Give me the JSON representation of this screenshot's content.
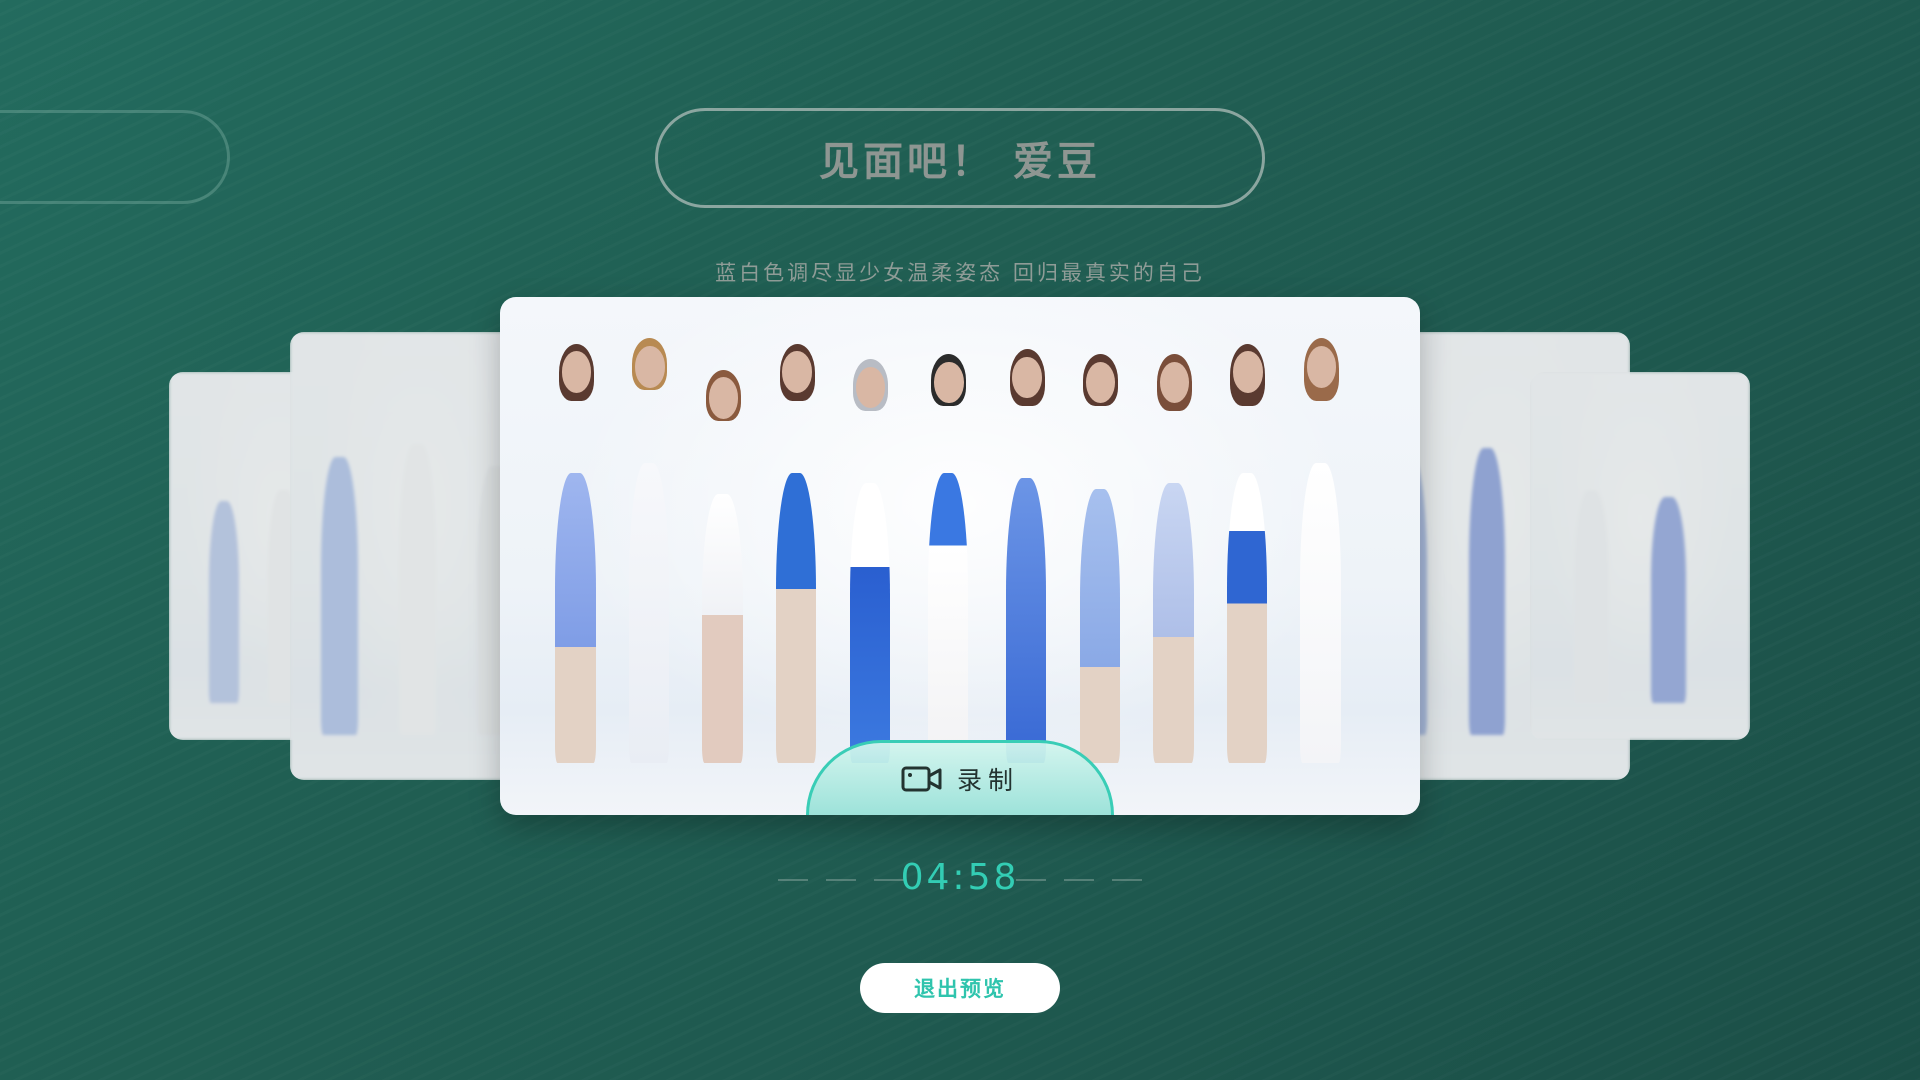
{
  "header": {
    "title": "见面吧！ 爱豆",
    "subtitle": "蓝白色调尽显少女温柔姿态 回归最真实的自己"
  },
  "preview": {
    "record_label": "录制",
    "record_icon": "video-camera-icon",
    "timer": "04:58"
  },
  "actions": {
    "exit_label": "退出预览"
  },
  "colors": {
    "accent": "#33cdb4",
    "background": "#205f53"
  }
}
